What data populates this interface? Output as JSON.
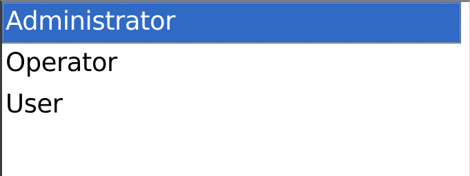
{
  "listbox": {
    "items": [
      {
        "label": "Administrator",
        "selected": true
      },
      {
        "label": "Operator",
        "selected": false
      },
      {
        "label": "User",
        "selected": false
      }
    ]
  },
  "colors": {
    "selection_background": "#316ac5",
    "selection_text": "#ffffff",
    "text": "#000000",
    "background": "#ffffff"
  }
}
